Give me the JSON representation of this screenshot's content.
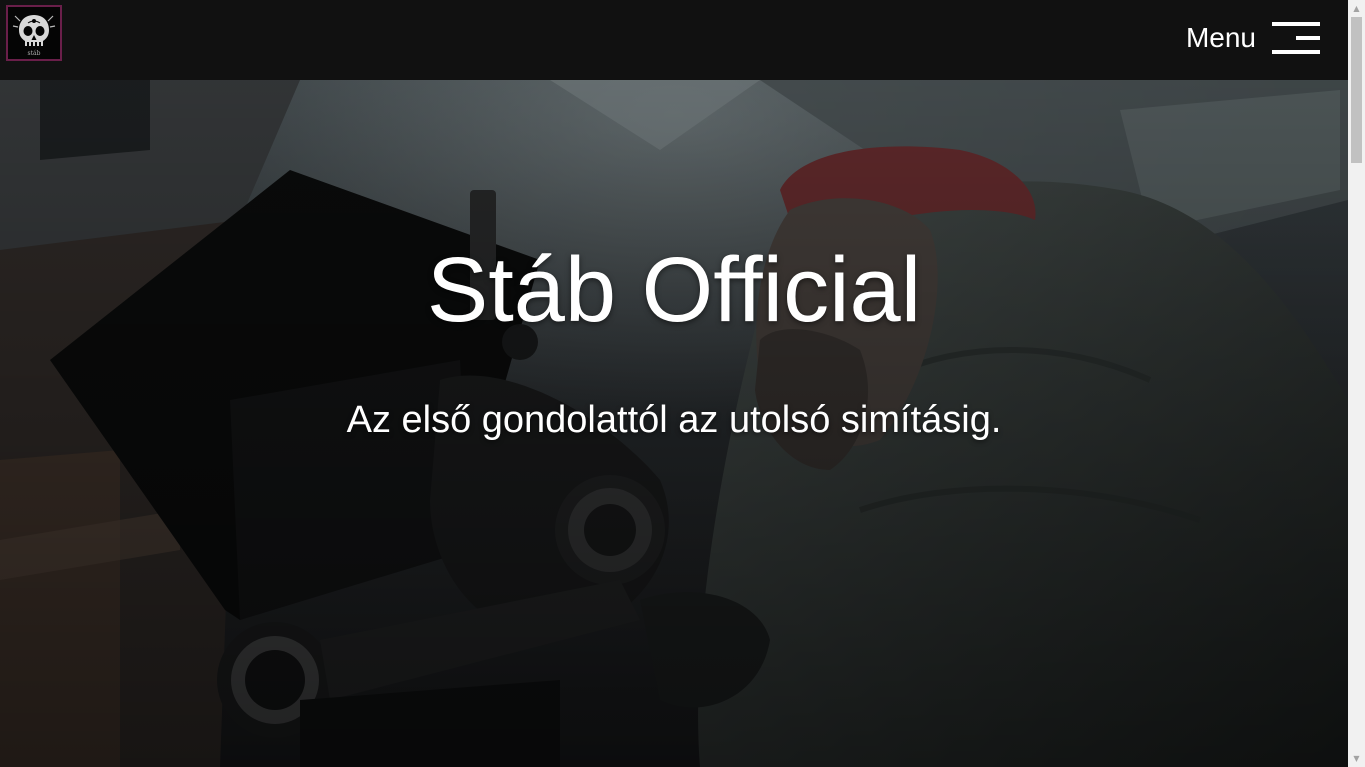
{
  "header": {
    "logo_name": "stáb",
    "menu_label": "Menu",
    "menu_icon": "hamburger-icon"
  },
  "hero": {
    "title": "Stáb Official",
    "subtitle": "Az első gondolattól az utolsó simításig."
  },
  "colors": {
    "header_bg": "#111111",
    "logo_border": "#6a1f4a",
    "text": "#ffffff"
  }
}
